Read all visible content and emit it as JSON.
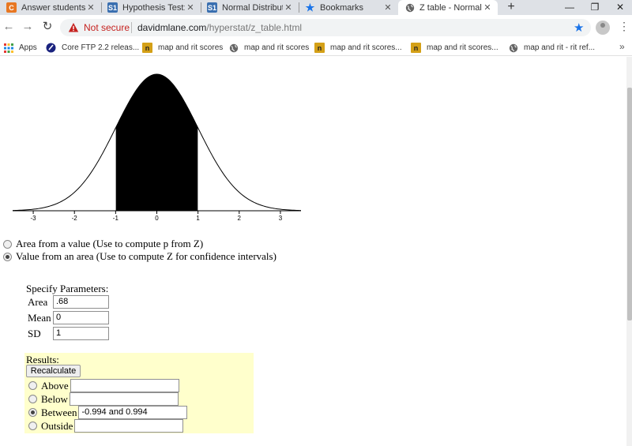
{
  "browser": {
    "tabs": [
      {
        "title": "Answer students' ",
        "icon": "chegg-icon",
        "active": false
      },
      {
        "title": "Hypothesis Test: D",
        "icon": "s1-icon",
        "active": false
      },
      {
        "title": "Normal Distributi",
        "icon": "s1-icon",
        "active": false
      },
      {
        "title": "Bookmarks",
        "icon": "star-icon",
        "active": false
      },
      {
        "title": "Z table - Normal",
        "icon": "globe-icon",
        "active": true
      }
    ],
    "new_tab_symbol": "+",
    "address": {
      "security_label": "Not secure",
      "url_host": "davidmlane.com",
      "url_path": "/hyperstat/z_table.html"
    },
    "bookmarks": [
      {
        "label": "Apps",
        "icon": "apps-grid-icon"
      },
      {
        "label": "Core FTP 2.2 releas...",
        "icon": "coreftp-icon"
      },
      {
        "label": "map and rit scores",
        "icon": "nwea-icon"
      },
      {
        "label": "map and rit scores",
        "icon": "globe-icon"
      },
      {
        "label": "map and rit scores...",
        "icon": "nwea-icon"
      },
      {
        "label": "map and rit scores...",
        "icon": "nwea-icon"
      },
      {
        "label": "map and rit - rit ref...",
        "icon": "globe-icon"
      }
    ],
    "more_bookmarks_symbol": "»"
  },
  "chart_data": {
    "type": "area",
    "distribution": "standard normal",
    "mean": 0,
    "sd": 1,
    "xlim": [
      -3.5,
      3.5
    ],
    "ticks": [
      -3,
      -2,
      -1,
      0,
      1,
      2,
      3
    ],
    "tick_labels": [
      "-3",
      "-2",
      "-1",
      "0",
      "1",
      "2",
      "3"
    ],
    "shaded_region": {
      "from": -0.994,
      "to": 0.994,
      "mode": "between"
    },
    "shade_color": "#000000",
    "curve_color": "#000000"
  },
  "mode_options": [
    {
      "label": "Area from a value (Use to compute p from Z)",
      "checked": false
    },
    {
      "label": "Value from an area (Use to compute Z for confidence intervals)",
      "checked": true
    }
  ],
  "parameters": {
    "title": "Specify Parameters:",
    "area_label": "Area",
    "area_value": ".68",
    "mean_label": "Mean",
    "mean_value": "0",
    "sd_label": "SD",
    "sd_value": "1"
  },
  "results": {
    "title": "Results:",
    "recalculate_label": "Recalculate",
    "background": "#ffffcc",
    "options": [
      {
        "label": "Above",
        "value": "",
        "checked": false
      },
      {
        "label": "Below",
        "value": "",
        "checked": false
      },
      {
        "label": "Between",
        "value": "-0.994 and 0.994",
        "checked": true
      },
      {
        "label": "Outside",
        "value": "",
        "checked": false
      }
    ]
  }
}
